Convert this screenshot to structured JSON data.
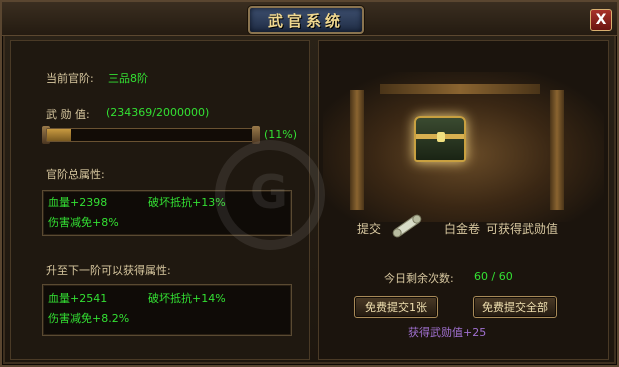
{
  "window": {
    "title": "武官系统",
    "close_label": "X"
  },
  "left": {
    "rank_label": "当前官阶:",
    "rank_value": "三品8阶",
    "merit_label": "武 勋 值:",
    "merit_value": "(234369/2000000)",
    "merit_percent_text": "(11%)",
    "merit_progress": 0.117,
    "total_attr_title": "官阶总属性:",
    "total_attrs": [
      {
        "name": "血量",
        "value": "+2398"
      },
      {
        "name": "破坏抵抗",
        "value": "+13%"
      },
      {
        "name": "伤害减免",
        "value": "+8%"
      }
    ],
    "next_attr_title": "升至下一阶可以获得属性:",
    "next_attrs": [
      {
        "name": "血量",
        "value": "+2541"
      },
      {
        "name": "破坏抵抗",
        "value": "+14%"
      },
      {
        "name": "伤害减免",
        "value": "+8.2%"
      }
    ]
  },
  "right": {
    "submit_label": "提交",
    "item_name": "白金卷",
    "reward_text": "可获得武勋值",
    "remaining_label": "今日剩余次数:",
    "remaining_value": "60 / 60",
    "btn_submit_one": "免费提交1张",
    "btn_submit_all": "免费提交全部",
    "gain_text": "获得武勋值+25"
  },
  "colors": {
    "accent_green": "#33e033",
    "gold": "#f0d890",
    "gain_purple": "#a070d0"
  },
  "icons": {
    "chest": "treasure-chest-icon",
    "scroll": "scroll-icon",
    "close": "close-icon"
  }
}
